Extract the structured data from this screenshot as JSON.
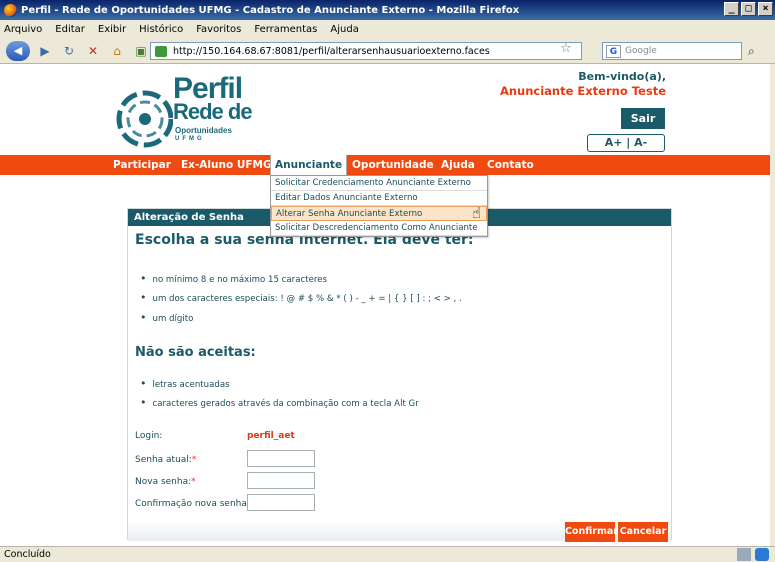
{
  "window": {
    "title": "Perfil - Rede de Oportunidades UFMG - Cadastro de Anunciante Externo - Mozilla Firefox",
    "buttons": [
      "_",
      "□",
      "×"
    ]
  },
  "menubar": [
    "Arquivo",
    "Editar",
    "Exibir",
    "Histórico",
    "Favoritos",
    "Ferramentas",
    "Ajuda"
  ],
  "browser": {
    "url": "http://150.164.68.67:8081/perfil/alterarsenhausuarioexterno.faces",
    "search_placeholder": "Google",
    "search_engine_letter": "G"
  },
  "header": {
    "logo": {
      "line1": "Perfil",
      "line2": "Rede de",
      "line3": "Oportunidades",
      "line4": "UFMG"
    },
    "welcome": "Bem-vindo(a),",
    "user_name": "Anunciante Externo Teste",
    "logout_label": "Sair",
    "font_controls": "A+ | A-"
  },
  "nav": {
    "items": [
      "Participar",
      "Ex-Aluno UFMG",
      "Anunciante",
      "Oportunidade",
      "Ajuda",
      "Contato"
    ],
    "active": "Anunciante",
    "dropdown": [
      "Solicitar Credenciamento Anunciante Externo",
      "Editar Dados Anunciante Externo",
      "Alterar Senha Anunciante Externo",
      "Solicitar Descredenciamento Como Anunciante"
    ],
    "dropdown_hover_index": 2
  },
  "panel": {
    "title": "Alteração de Senha",
    "heading_requirements": "Escolha a sua senha internet. Ela deve ter:",
    "requirements": [
      "no mínimo 8 e no máximo 15 caracteres",
      "um dos caracteres especiais: ! @ # $ % & * ( ) - _ + = | { } [ ] : ; < > , .",
      "um dígito"
    ],
    "heading_not_accepted": "Não são aceitas:",
    "not_accepted": [
      "letras acentuadas",
      "caracteres gerados através da combinação com a tecla Alt Gr"
    ],
    "form": {
      "login_label": "Login:",
      "login_value": "perfil_aet",
      "current_password_label": "Senha atual:",
      "new_password_label": "Nova senha:",
      "confirm_password_label": "Confirmação nova senha:",
      "required_mark": "*"
    },
    "confirm_label": "Confirmar",
    "cancel_label": "Cancelar"
  },
  "statusbar": {
    "text": "Concluído"
  },
  "colors": {
    "teal": "#1b5a68",
    "orange": "#f04a10",
    "required": "#e03020"
  }
}
